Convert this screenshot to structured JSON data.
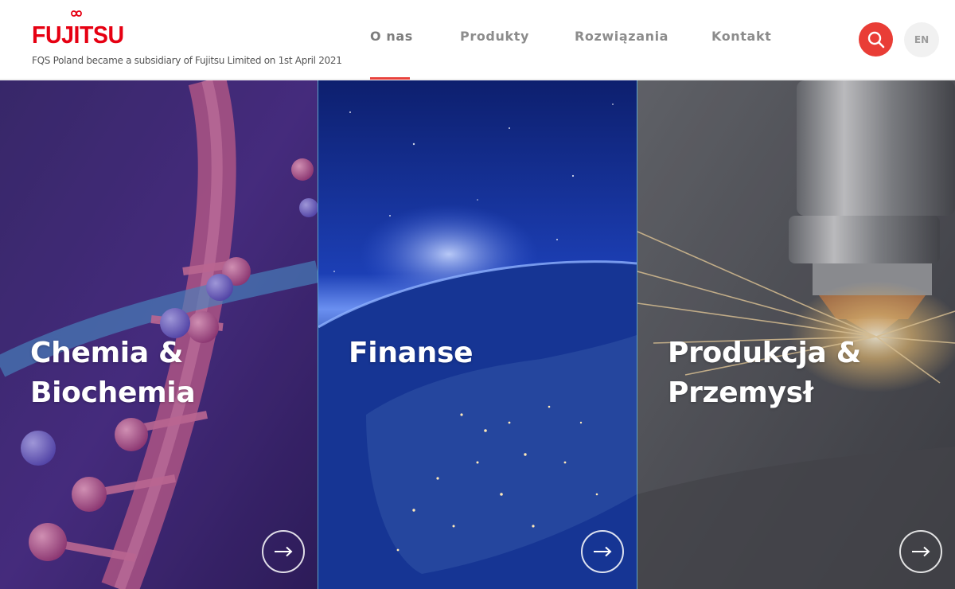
{
  "brand": {
    "logo_text": "FUJITSU",
    "tagline": "FQS Poland became a subsidiary of Fujitsu Limited on 1st April 2021",
    "accent_color": "#e60012"
  },
  "nav": {
    "items": [
      {
        "label": "O nas",
        "active": true
      },
      {
        "label": "Produkty",
        "active": false
      },
      {
        "label": "Rozwiązania",
        "active": false
      },
      {
        "label": "Kontakt",
        "active": false
      }
    ],
    "search_icon": "search-icon",
    "language": "EN"
  },
  "panels": [
    {
      "title": "Chemia &\nBiochemia",
      "theme": "dna-molecule",
      "arrow_icon": "arrow-right-icon"
    },
    {
      "title": "Finanse",
      "theme": "earth-night-lights",
      "arrow_icon": "arrow-right-icon"
    },
    {
      "title": "Produkcja &\nPrzemysł",
      "theme": "laser-cutting-sparks",
      "arrow_icon": "arrow-right-icon"
    }
  ],
  "colors": {
    "search_button": "#e93d36",
    "nav_underline": "#e8423c",
    "nav_text": "#8c8c8c"
  }
}
